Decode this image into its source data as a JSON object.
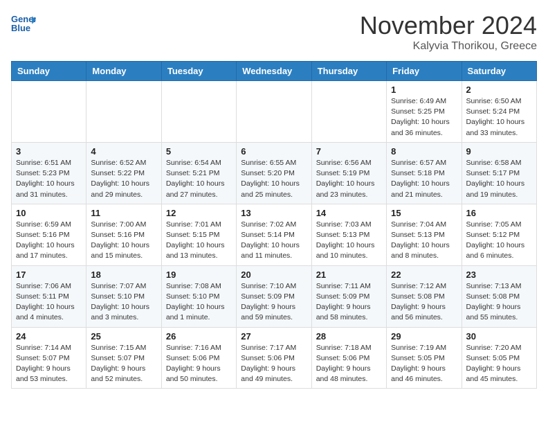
{
  "header": {
    "logo_line1": "General",
    "logo_line2": "Blue",
    "month": "November 2024",
    "location": "Kalyvia Thorikou, Greece"
  },
  "weekdays": [
    "Sunday",
    "Monday",
    "Tuesday",
    "Wednesday",
    "Thursday",
    "Friday",
    "Saturday"
  ],
  "weeks": [
    [
      {
        "day": "",
        "info": ""
      },
      {
        "day": "",
        "info": ""
      },
      {
        "day": "",
        "info": ""
      },
      {
        "day": "",
        "info": ""
      },
      {
        "day": "",
        "info": ""
      },
      {
        "day": "1",
        "info": "Sunrise: 6:49 AM\nSunset: 5:25 PM\nDaylight: 10 hours\nand 36 minutes."
      },
      {
        "day": "2",
        "info": "Sunrise: 6:50 AM\nSunset: 5:24 PM\nDaylight: 10 hours\nand 33 minutes."
      }
    ],
    [
      {
        "day": "3",
        "info": "Sunrise: 6:51 AM\nSunset: 5:23 PM\nDaylight: 10 hours\nand 31 minutes."
      },
      {
        "day": "4",
        "info": "Sunrise: 6:52 AM\nSunset: 5:22 PM\nDaylight: 10 hours\nand 29 minutes."
      },
      {
        "day": "5",
        "info": "Sunrise: 6:54 AM\nSunset: 5:21 PM\nDaylight: 10 hours\nand 27 minutes."
      },
      {
        "day": "6",
        "info": "Sunrise: 6:55 AM\nSunset: 5:20 PM\nDaylight: 10 hours\nand 25 minutes."
      },
      {
        "day": "7",
        "info": "Sunrise: 6:56 AM\nSunset: 5:19 PM\nDaylight: 10 hours\nand 23 minutes."
      },
      {
        "day": "8",
        "info": "Sunrise: 6:57 AM\nSunset: 5:18 PM\nDaylight: 10 hours\nand 21 minutes."
      },
      {
        "day": "9",
        "info": "Sunrise: 6:58 AM\nSunset: 5:17 PM\nDaylight: 10 hours\nand 19 minutes."
      }
    ],
    [
      {
        "day": "10",
        "info": "Sunrise: 6:59 AM\nSunset: 5:16 PM\nDaylight: 10 hours\nand 17 minutes."
      },
      {
        "day": "11",
        "info": "Sunrise: 7:00 AM\nSunset: 5:16 PM\nDaylight: 10 hours\nand 15 minutes."
      },
      {
        "day": "12",
        "info": "Sunrise: 7:01 AM\nSunset: 5:15 PM\nDaylight: 10 hours\nand 13 minutes."
      },
      {
        "day": "13",
        "info": "Sunrise: 7:02 AM\nSunset: 5:14 PM\nDaylight: 10 hours\nand 11 minutes."
      },
      {
        "day": "14",
        "info": "Sunrise: 7:03 AM\nSunset: 5:13 PM\nDaylight: 10 hours\nand 10 minutes."
      },
      {
        "day": "15",
        "info": "Sunrise: 7:04 AM\nSunset: 5:13 PM\nDaylight: 10 hours\nand 8 minutes."
      },
      {
        "day": "16",
        "info": "Sunrise: 7:05 AM\nSunset: 5:12 PM\nDaylight: 10 hours\nand 6 minutes."
      }
    ],
    [
      {
        "day": "17",
        "info": "Sunrise: 7:06 AM\nSunset: 5:11 PM\nDaylight: 10 hours\nand 4 minutes."
      },
      {
        "day": "18",
        "info": "Sunrise: 7:07 AM\nSunset: 5:10 PM\nDaylight: 10 hours\nand 3 minutes."
      },
      {
        "day": "19",
        "info": "Sunrise: 7:08 AM\nSunset: 5:10 PM\nDaylight: 10 hours\nand 1 minute."
      },
      {
        "day": "20",
        "info": "Sunrise: 7:10 AM\nSunset: 5:09 PM\nDaylight: 9 hours\nand 59 minutes."
      },
      {
        "day": "21",
        "info": "Sunrise: 7:11 AM\nSunset: 5:09 PM\nDaylight: 9 hours\nand 58 minutes."
      },
      {
        "day": "22",
        "info": "Sunrise: 7:12 AM\nSunset: 5:08 PM\nDaylight: 9 hours\nand 56 minutes."
      },
      {
        "day": "23",
        "info": "Sunrise: 7:13 AM\nSunset: 5:08 PM\nDaylight: 9 hours\nand 55 minutes."
      }
    ],
    [
      {
        "day": "24",
        "info": "Sunrise: 7:14 AM\nSunset: 5:07 PM\nDaylight: 9 hours\nand 53 minutes."
      },
      {
        "day": "25",
        "info": "Sunrise: 7:15 AM\nSunset: 5:07 PM\nDaylight: 9 hours\nand 52 minutes."
      },
      {
        "day": "26",
        "info": "Sunrise: 7:16 AM\nSunset: 5:06 PM\nDaylight: 9 hours\nand 50 minutes."
      },
      {
        "day": "27",
        "info": "Sunrise: 7:17 AM\nSunset: 5:06 PM\nDaylight: 9 hours\nand 49 minutes."
      },
      {
        "day": "28",
        "info": "Sunrise: 7:18 AM\nSunset: 5:06 PM\nDaylight: 9 hours\nand 48 minutes."
      },
      {
        "day": "29",
        "info": "Sunrise: 7:19 AM\nSunset: 5:05 PM\nDaylight: 9 hours\nand 46 minutes."
      },
      {
        "day": "30",
        "info": "Sunrise: 7:20 AM\nSunset: 5:05 PM\nDaylight: 9 hours\nand 45 minutes."
      }
    ]
  ]
}
